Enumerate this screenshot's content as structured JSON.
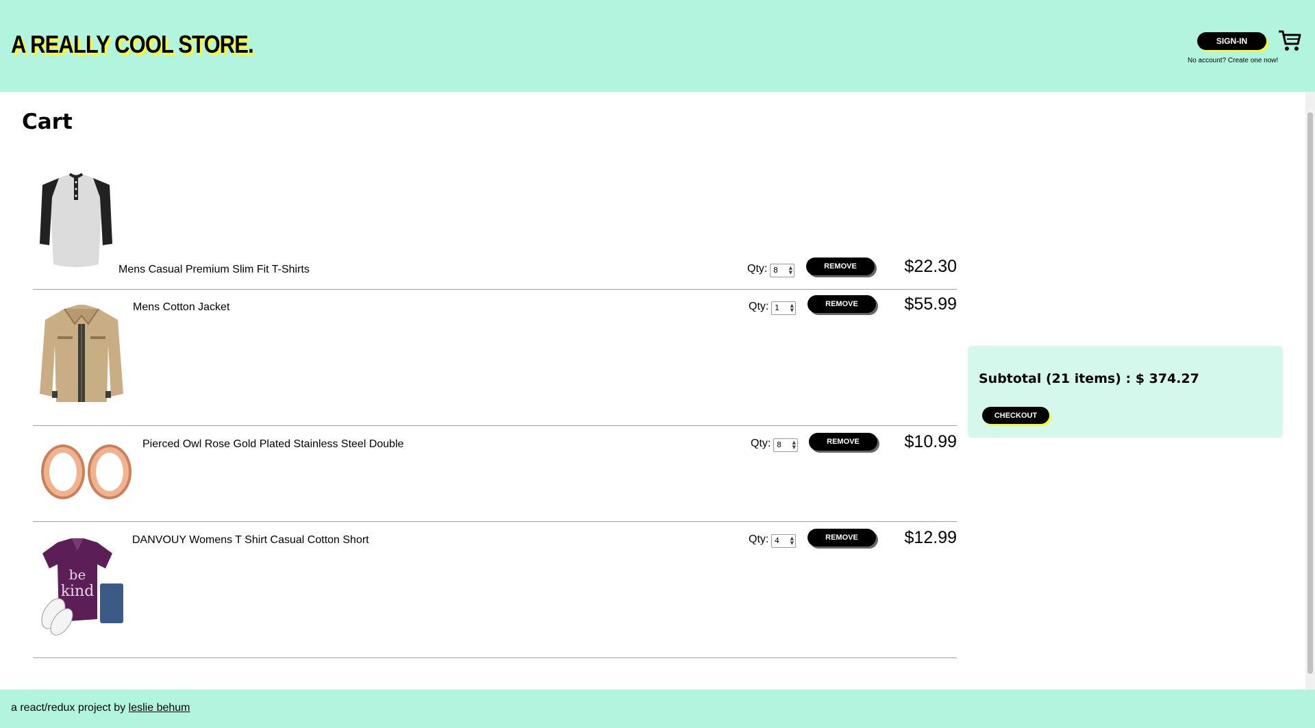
{
  "header": {
    "logo": "A REALLY COOL STORE.",
    "signin_label": "SIGN-IN",
    "account_note": "No account? Create one now!"
  },
  "page": {
    "title": "Cart"
  },
  "cart": {
    "qty_label": "Qty:",
    "remove_label": "REMOVE",
    "items": [
      {
        "title": "Mens Casual Premium Slim Fit T-Shirts",
        "qty": "8",
        "price": "$22.30"
      },
      {
        "title": "Mens Cotton Jacket",
        "qty": "1",
        "price": "$55.99"
      },
      {
        "title": "Pierced Owl Rose Gold Plated Stainless Steel Double",
        "qty": "8",
        "price": "$10.99"
      },
      {
        "title": "DANVOUY Womens T Shirt Casual Cotton Short",
        "qty": "4",
        "price": "$12.99"
      }
    ]
  },
  "summary": {
    "subtotal": "Subtotal (21 items) : $ 374.27",
    "checkout_label": "CHECKOUT"
  },
  "footer": {
    "prefix": "a react/redux project by",
    "link": "leslie behum"
  },
  "colors": {
    "accent": "#b2f5de",
    "panel": "#d4f8ec",
    "highlight": "#f6f63a"
  },
  "icons": [
    "cart-icon"
  ]
}
